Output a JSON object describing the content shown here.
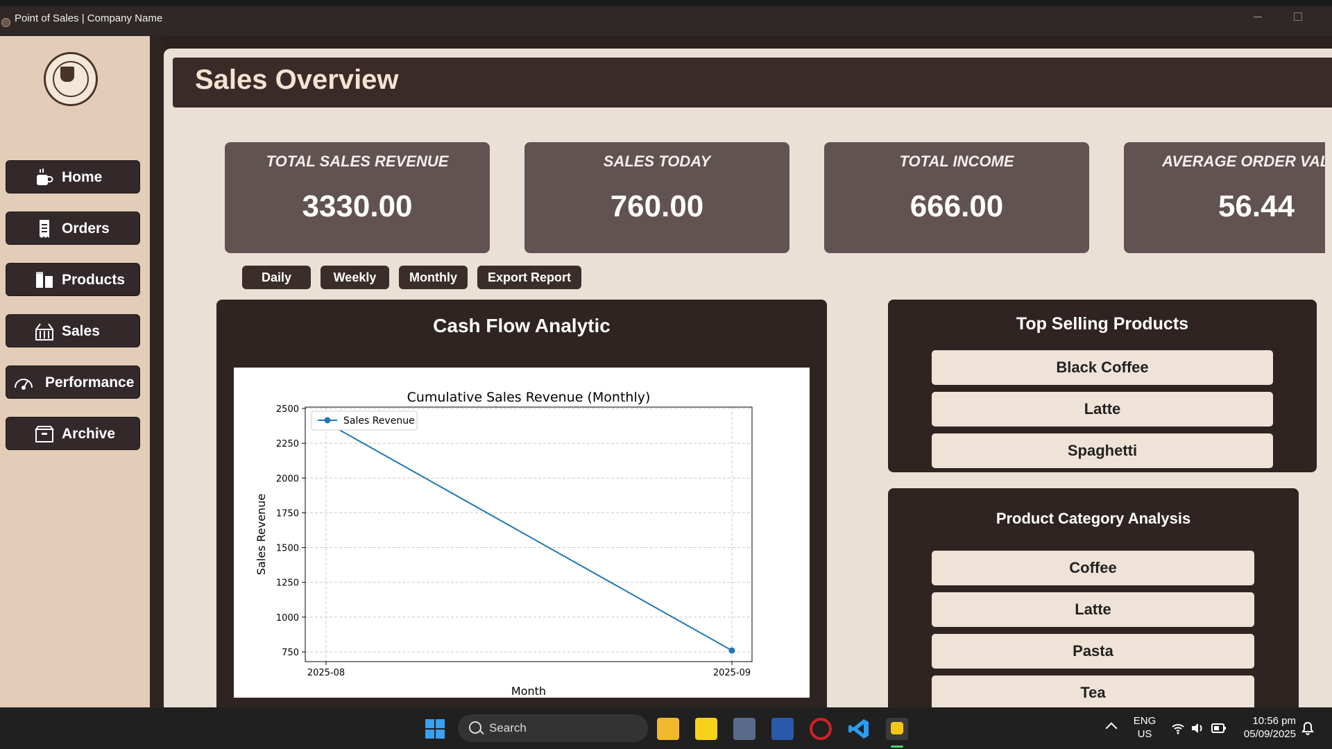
{
  "window": {
    "title": "Point of Sales | Company Name"
  },
  "logo": {
    "text": "COFFEE SHOP DUMMY LOGO"
  },
  "nav": [
    {
      "label": "Home",
      "icon": "coffee-cup-icon"
    },
    {
      "label": "Orders",
      "icon": "receipt-icon"
    },
    {
      "label": "Products",
      "icon": "products-icon"
    },
    {
      "label": "Sales",
      "icon": "basket-icon"
    },
    {
      "label": "Performance",
      "icon": "gauge-icon"
    },
    {
      "label": "Archive",
      "icon": "archive-box-icon"
    }
  ],
  "page": {
    "title": "Sales Overview"
  },
  "cards": [
    {
      "title": "TOTAL SALES REVENUE",
      "value": "3330.00"
    },
    {
      "title": "SALES TODAY",
      "value": "760.00"
    },
    {
      "title": "TOTAL INCOME",
      "value": "666.00"
    },
    {
      "title": "AVERAGE ORDER VALUE",
      "value": "56.44"
    }
  ],
  "range_buttons": [
    "Daily",
    "Weekly",
    "Monthly",
    "Export Report"
  ],
  "cash_flow": {
    "title": "Cash Flow Analytic"
  },
  "chart_data": {
    "type": "line",
    "title": "Cumulative Sales Revenue (Monthly)",
    "xlabel": "Month",
    "ylabel": "Sales Revenue",
    "x": [
      "2025-08",
      "2025-09"
    ],
    "series": [
      {
        "name": "Sales Revenue",
        "values": [
          2400,
          760
        ],
        "color": "#1f77b4"
      }
    ],
    "ylim": [
      680,
      2510
    ],
    "yticks": [
      750,
      1000,
      1250,
      1500,
      1750,
      2000,
      2250,
      2500
    ],
    "grid": true,
    "legend": "top-left"
  },
  "top_selling": {
    "title": "Top Selling Products",
    "items": [
      "Black Coffee",
      "Latte",
      "Spaghetti"
    ]
  },
  "category_analysis": {
    "title": "Product Category Analysis",
    "items": [
      "Coffee",
      "Latte",
      "Pasta",
      "Tea"
    ]
  },
  "taskbar": {
    "search_placeholder": "Search",
    "lang_line1": "ENG",
    "lang_line2": "US",
    "time": "10:56 pm",
    "date": "05/09/2025"
  },
  "colors": {
    "accent": "#1f77b4",
    "sidebar": "#e3cdb8",
    "dark": "#2f2422",
    "card": "#615352"
  }
}
